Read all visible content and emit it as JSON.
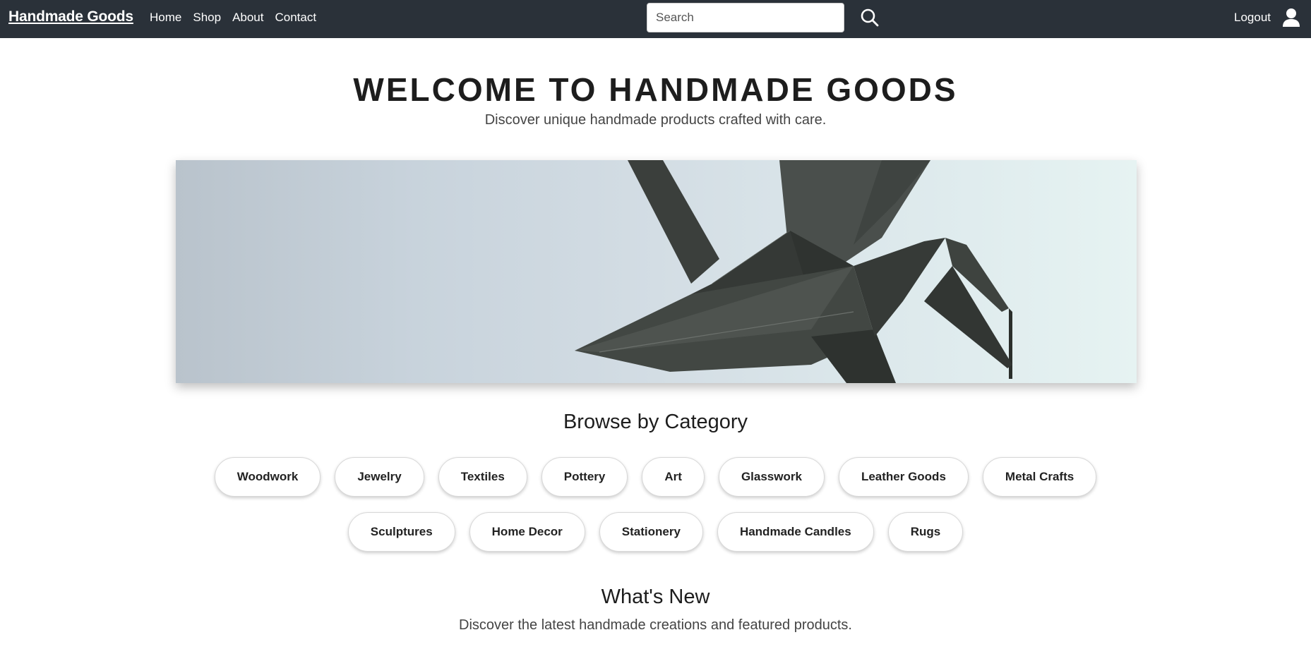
{
  "navbar": {
    "brand": "Handmade Goods",
    "links": [
      "Home",
      "Shop",
      "About",
      "Contact"
    ],
    "search_placeholder": "Search",
    "logout_label": "Logout",
    "background_color": "#2a3139"
  },
  "hero": {
    "title": "WELCOME TO HANDMADE GOODS",
    "subtitle": "Discover unique handmade products crafted with care."
  },
  "banner": {
    "subject": "origami-crane-image"
  },
  "categories": {
    "title": "Browse by Category",
    "row1": [
      "Woodwork",
      "Jewelry",
      "Textiles",
      "Pottery",
      "Art",
      "Glasswork",
      "Leather Goods",
      "Metal Crafts"
    ],
    "row2": [
      "Sculptures",
      "Home Decor",
      "Stationery",
      "Handmade Candles",
      "Rugs"
    ]
  },
  "whats_new": {
    "title": "What's New",
    "subtitle": "Discover the latest handmade creations and featured products."
  }
}
